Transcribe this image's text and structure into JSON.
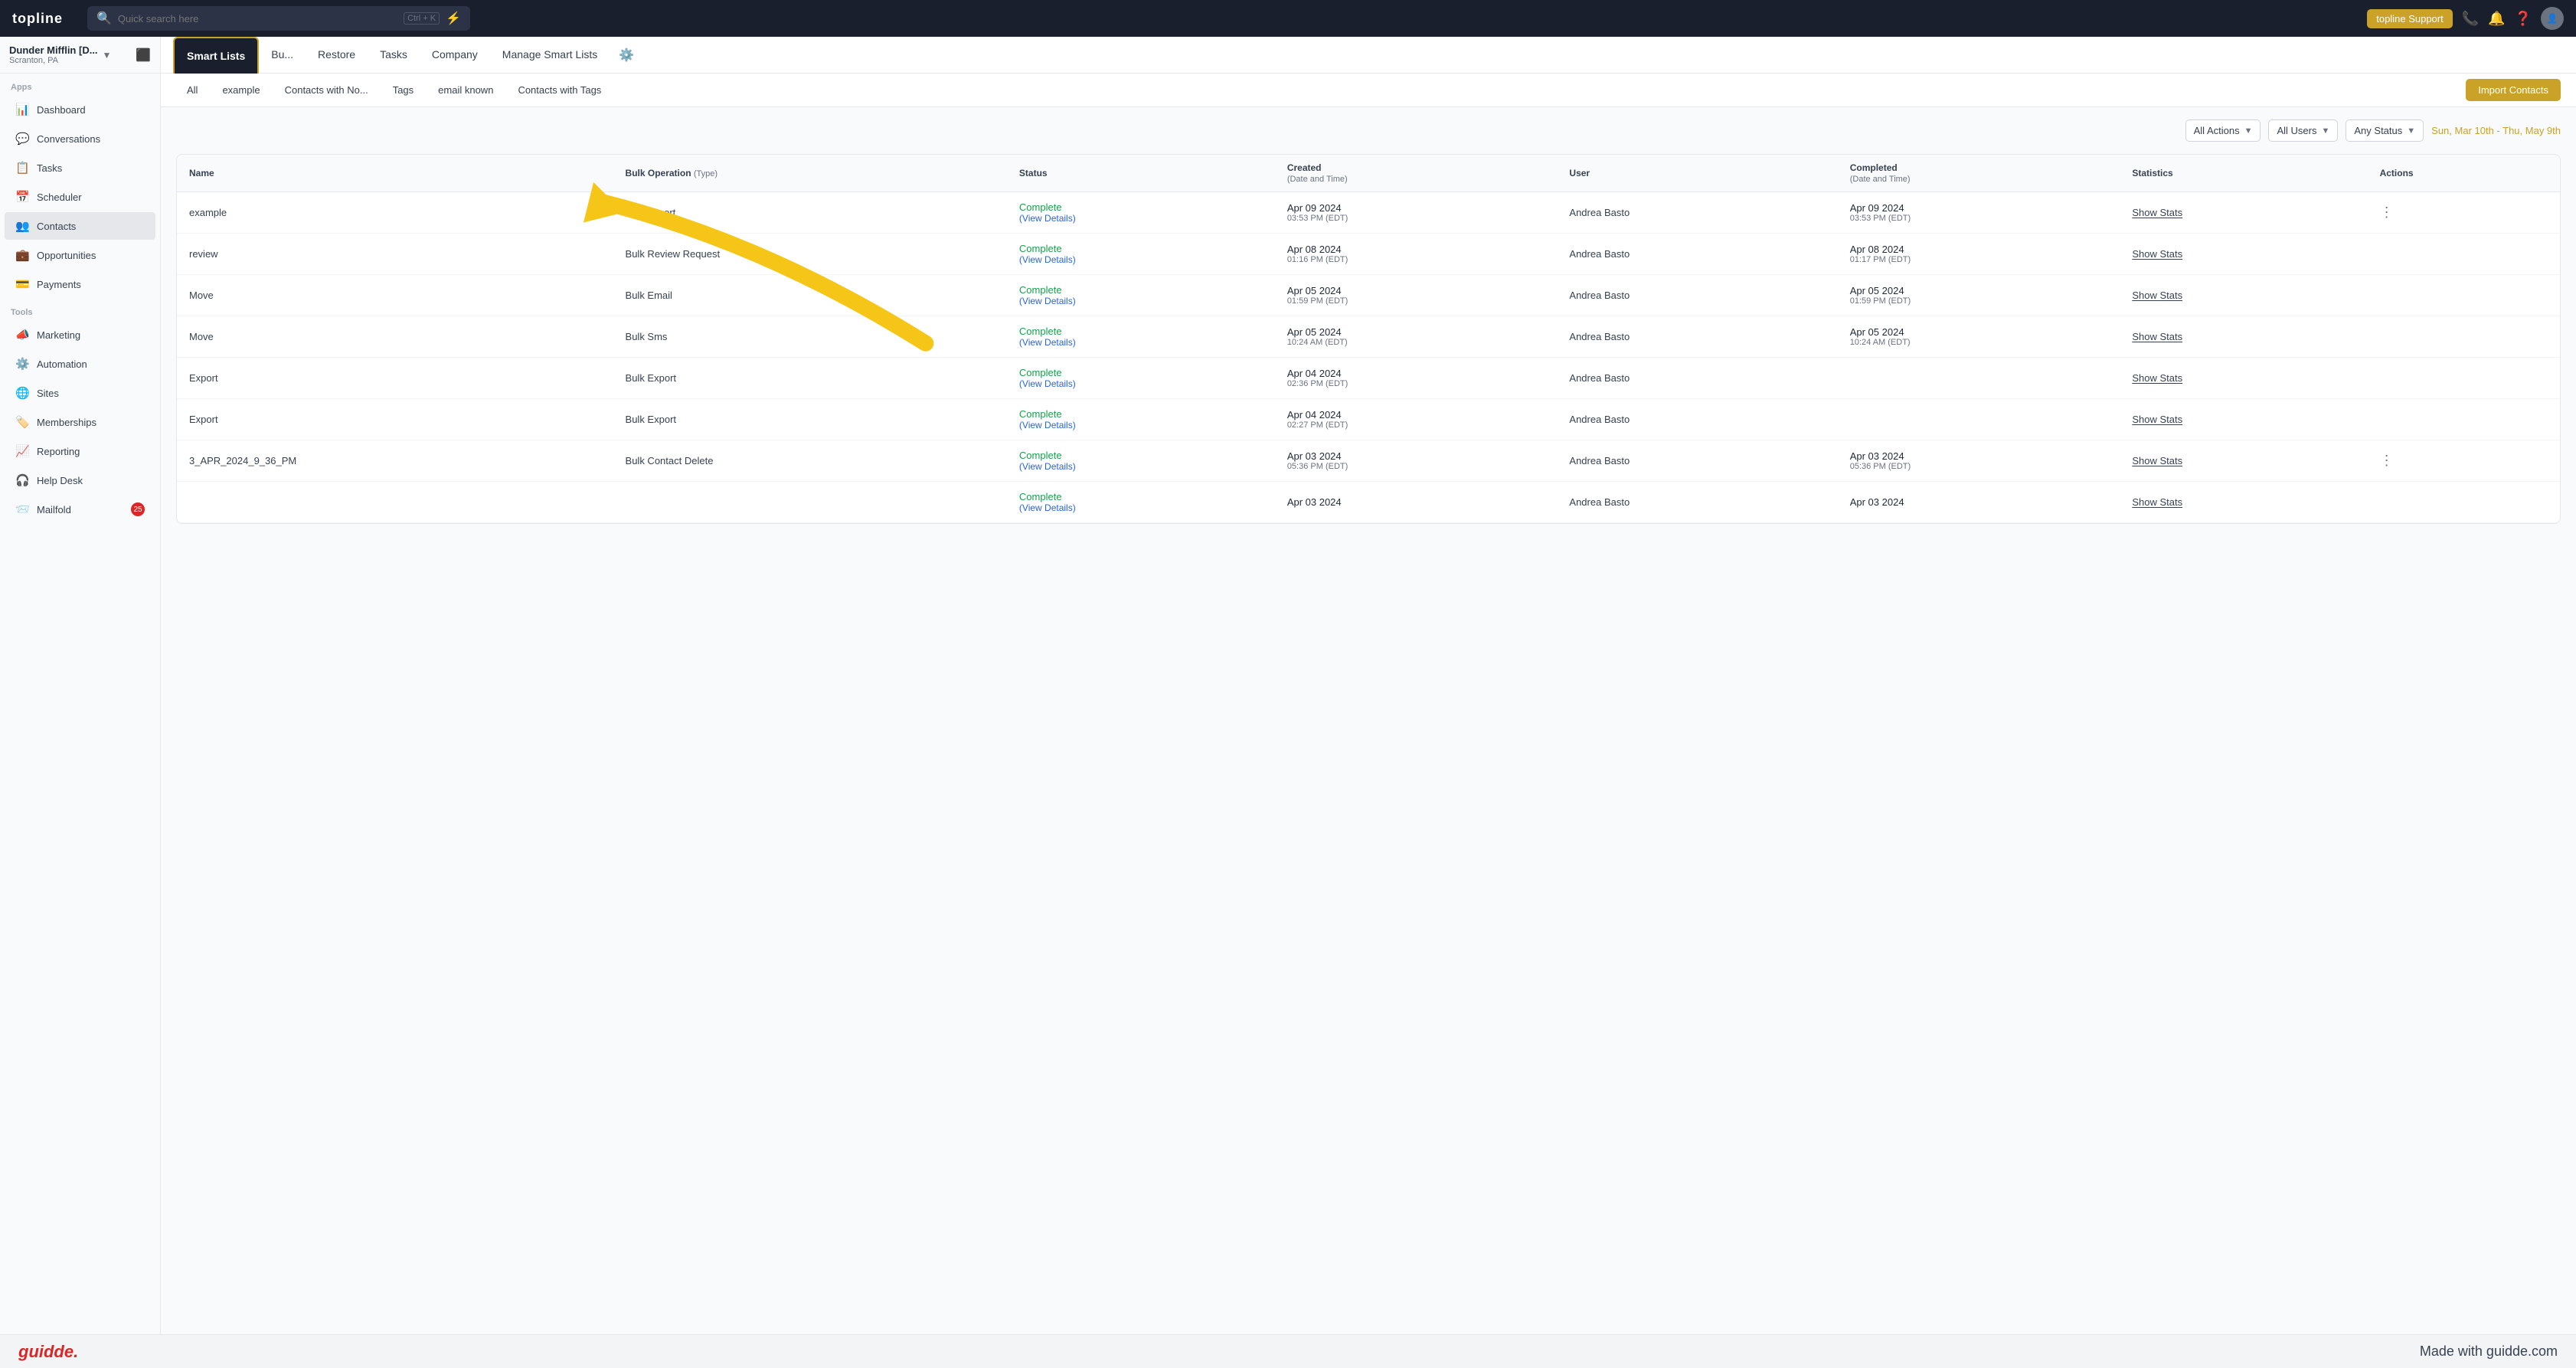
{
  "app": {
    "logo": "topline",
    "search_placeholder": "Quick search here",
    "search_shortcut": "Ctrl + K",
    "support_label": "topline Support"
  },
  "workspace": {
    "name": "Dunder Mifflin [D...",
    "location": "Scranton, PA"
  },
  "sidebar": {
    "apps_label": "Apps",
    "tools_label": "Tools",
    "items": [
      {
        "id": "dashboard",
        "label": "Dashboard",
        "icon": "📊"
      },
      {
        "id": "conversations",
        "label": "Conversations",
        "icon": "💬"
      },
      {
        "id": "tasks",
        "label": "Tasks",
        "icon": "📋"
      },
      {
        "id": "scheduler",
        "label": "Scheduler",
        "icon": "📅"
      },
      {
        "id": "contacts",
        "label": "Contacts",
        "icon": "👥"
      },
      {
        "id": "opportunities",
        "label": "Opportunities",
        "icon": "💼"
      },
      {
        "id": "payments",
        "label": "Payments",
        "icon": "💳"
      }
    ],
    "tools_items": [
      {
        "id": "marketing",
        "label": "Marketing",
        "icon": "📣"
      },
      {
        "id": "automation",
        "label": "Automation",
        "icon": "⚙️"
      },
      {
        "id": "sites",
        "label": "Sites",
        "icon": "🌐"
      },
      {
        "id": "memberships",
        "label": "Memberships",
        "icon": "🏷️"
      },
      {
        "id": "reporting",
        "label": "Reporting",
        "icon": "📈"
      },
      {
        "id": "helpdesk",
        "label": "Help Desk",
        "icon": "🎧"
      },
      {
        "id": "mailfold",
        "label": "Mailfold",
        "icon": "📨",
        "badge": "25"
      }
    ]
  },
  "tabs": [
    {
      "id": "smart-lists",
      "label": "Smart Lists",
      "active": true
    },
    {
      "id": "bulk",
      "label": "Bu..."
    },
    {
      "id": "restore",
      "label": "Restore"
    },
    {
      "id": "tasks",
      "label": "Tasks"
    },
    {
      "id": "company",
      "label": "Company"
    },
    {
      "id": "manage-smart-lists",
      "label": "Manage Smart Lists"
    }
  ],
  "sub_tabs": [
    {
      "id": "all",
      "label": "All"
    },
    {
      "id": "example",
      "label": "example"
    },
    {
      "id": "contacts-no",
      "label": "Contacts with No..."
    },
    {
      "id": "tags",
      "label": "Tags"
    },
    {
      "id": "email-known",
      "label": "email known"
    },
    {
      "id": "contacts-tags",
      "label": "Contacts with Tags"
    }
  ],
  "import_button": "Import Contacts",
  "filters": {
    "all_actions": "All Actions",
    "all_users": "All Users",
    "any_status": "Any Status",
    "date_range": "Sun, Mar 10th - Thu, May 9th"
  },
  "table": {
    "columns": [
      {
        "label": "Name",
        "sub": ""
      },
      {
        "label": "Bulk Operation",
        "sub": "(Type)"
      },
      {
        "label": "Status",
        "sub": ""
      },
      {
        "label": "Created",
        "sub": "(Date and Time)"
      },
      {
        "label": "User",
        "sub": ""
      },
      {
        "label": "Completed",
        "sub": "(Date and Time)"
      },
      {
        "label": "Statistics",
        "sub": ""
      },
      {
        "label": "Actions",
        "sub": ""
      }
    ],
    "rows": [
      {
        "name": "example",
        "operation": "Bulk Import",
        "status": "Complete",
        "status_detail": "(View Details)",
        "created_date": "Apr 09 2024",
        "created_time": "03:53 PM (EDT)",
        "user": "Andrea Basto",
        "completed_date": "Apr 09 2024",
        "completed_time": "03:53 PM (EDT)",
        "stats": "Show Stats",
        "has_menu": true
      },
      {
        "name": "review",
        "operation": "Bulk Review Request",
        "status": "Complete",
        "status_detail": "(View Details)",
        "created_date": "Apr 08 2024",
        "created_time": "01:16 PM (EDT)",
        "user": "Andrea Basto",
        "completed_date": "Apr 08 2024",
        "completed_time": "01:17 PM (EDT)",
        "stats": "Show Stats",
        "has_menu": false
      },
      {
        "name": "Move",
        "operation": "Bulk Email",
        "status": "Complete",
        "status_detail": "(View Details)",
        "created_date": "Apr 05 2024",
        "created_time": "01:59 PM (EDT)",
        "user": "Andrea Basto",
        "completed_date": "Apr 05 2024",
        "completed_time": "01:59 PM (EDT)",
        "stats": "Show Stats",
        "has_menu": false
      },
      {
        "name": "Move",
        "operation": "Bulk Sms",
        "status": "Complete",
        "status_detail": "(View Details)",
        "created_date": "Apr 05 2024",
        "created_time": "10:24 AM (EDT)",
        "user": "Andrea Basto",
        "completed_date": "Apr 05 2024",
        "completed_time": "10:24 AM (EDT)",
        "stats": "Show Stats",
        "has_menu": false
      },
      {
        "name": "Export",
        "operation": "Bulk Export",
        "status": "Complete",
        "status_detail": "(View Details)",
        "created_date": "Apr 04 2024",
        "created_time": "02:36 PM (EDT)",
        "user": "Andrea Basto",
        "completed_date": "",
        "completed_time": "",
        "stats": "Show Stats",
        "has_menu": false
      },
      {
        "name": "Export",
        "operation": "Bulk Export",
        "status": "Complete",
        "status_detail": "(View Details)",
        "created_date": "Apr 04 2024",
        "created_time": "02:27 PM (EDT)",
        "user": "Andrea Basto",
        "completed_date": "",
        "completed_time": "",
        "stats": "Show Stats",
        "has_menu": false
      },
      {
        "name": "3_APR_2024_9_36_PM",
        "operation": "Bulk Contact Delete",
        "status": "Complete",
        "status_detail": "(View Details)",
        "created_date": "Apr 03 2024",
        "created_time": "05:36 PM (EDT)",
        "user": "Andrea Basto",
        "completed_date": "Apr 03 2024",
        "completed_time": "05:36 PM (EDT)",
        "stats": "Show Stats",
        "has_menu": true
      },
      {
        "name": "",
        "operation": "",
        "status": "Complete",
        "status_detail": "(View Details)",
        "created_date": "Apr 03 2024",
        "created_time": "",
        "user": "Andrea Basto",
        "completed_date": "Apr 03 2024",
        "completed_time": "",
        "stats": "Show Stats",
        "has_menu": false
      }
    ]
  },
  "guidde": {
    "logo": "guidde.",
    "tagline": "Made with guidde.com"
  }
}
